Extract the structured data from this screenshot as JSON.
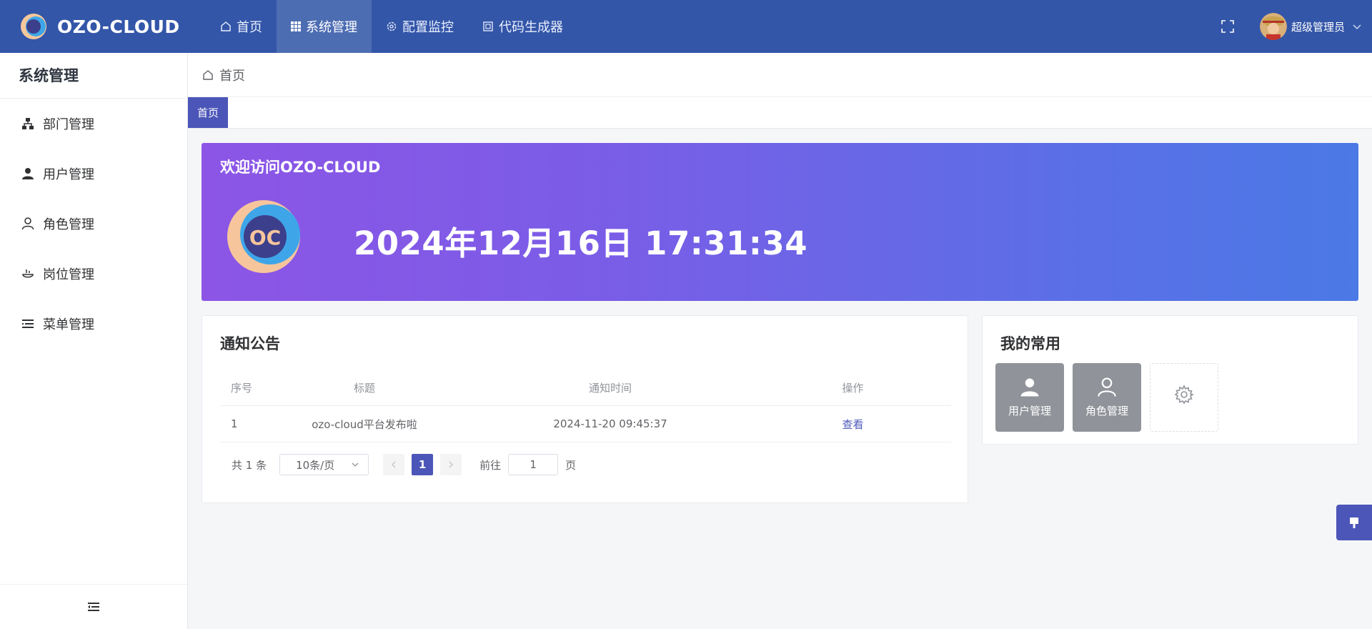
{
  "app": {
    "brand": "OZO-CLOUD",
    "nav": [
      {
        "label": "首页",
        "icon": "home-icon"
      },
      {
        "label": "系统管理",
        "icon": "grid-icon",
        "active": true
      },
      {
        "label": "配置监控",
        "icon": "gear-icon"
      },
      {
        "label": "代码生成器",
        "icon": "code-icon"
      }
    ],
    "user": "超级管理员"
  },
  "sidebar": {
    "title": "系统管理",
    "items": [
      {
        "label": "部门管理",
        "icon": "org-tree-icon"
      },
      {
        "label": "用户管理",
        "icon": "user-solid-icon"
      },
      {
        "label": "角色管理",
        "icon": "user-outline-icon"
      },
      {
        "label": "岗位管理",
        "icon": "post-icon"
      },
      {
        "label": "菜单管理",
        "icon": "menu-list-icon"
      }
    ]
  },
  "breadcrumb": {
    "current": "首页"
  },
  "tags": [
    {
      "label": "首页",
      "active": true
    }
  ],
  "banner": {
    "title": "欢迎访问OZO-CLOUD",
    "logo_text": "OC",
    "datetime": "2024年12月16日 17:31:34"
  },
  "notice": {
    "title": "通知公告",
    "columns": [
      "序号",
      "标题",
      "通知时间",
      "操作"
    ],
    "rows": [
      {
        "index": "1",
        "title": "ozo-cloud平台发布啦",
        "time": "2024-11-20 09:45:37",
        "action": "查看"
      }
    ],
    "pager": {
      "total": "共 1 条",
      "page_size": "10条/页",
      "current_page": "1",
      "goto_label": "前往",
      "goto_value": "1",
      "page_unit": "页"
    }
  },
  "common": {
    "title": "我的常用",
    "shortcuts": [
      {
        "label": "用户管理",
        "icon": "user-solid-icon"
      },
      {
        "label": "角色管理",
        "icon": "user-outline-icon"
      }
    ]
  },
  "colors": {
    "topbar": "#3356a8",
    "accent": "#4c56b8",
    "banner_start": "#8c55e6",
    "banner_end": "#4b79e6"
  }
}
